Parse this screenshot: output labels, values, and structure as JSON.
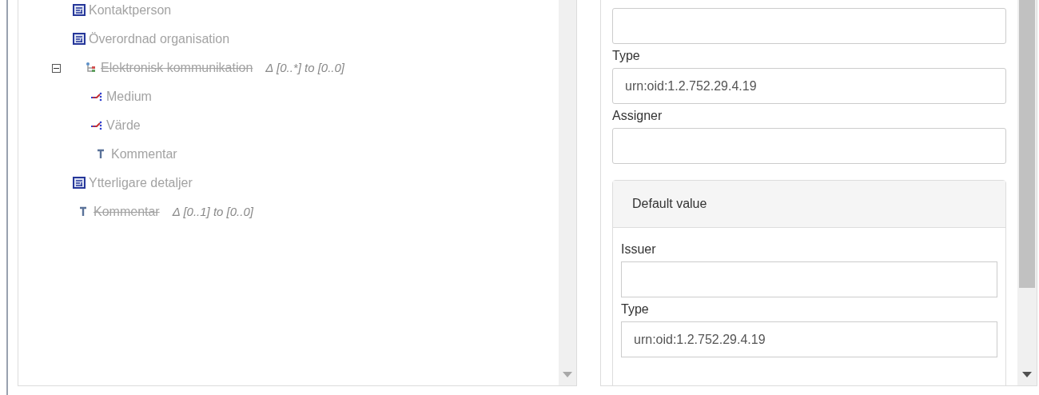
{
  "tree": {
    "items": [
      {
        "label": "Kontaktperson",
        "kind": "class",
        "deleted": false
      },
      {
        "label": "Överordnad organisation",
        "kind": "class",
        "deleted": false
      },
      {
        "label": "Elektronisk kommunikation",
        "kind": "group",
        "deleted": true,
        "delta": "Δ [0..*] to [0..0]",
        "expanded": true,
        "children": [
          {
            "label": "Medium",
            "kind": "attribute",
            "deleted": false
          },
          {
            "label": "Värde",
            "kind": "attribute",
            "deleted": false
          },
          {
            "label": "Kommentar",
            "kind": "text",
            "deleted": false
          }
        ]
      },
      {
        "label": "Ytterligare detaljer",
        "kind": "class",
        "deleted": false
      },
      {
        "label": "Kommentar",
        "kind": "text",
        "deleted": true,
        "delta": "Δ [0..1] to [0..0]"
      }
    ]
  },
  "form": {
    "fields": [
      {
        "kind": "input"
      },
      {
        "kind": "input",
        "label": "Type",
        "value": "urn:oid:1.2.752.29.4.19"
      },
      {
        "kind": "input",
        "label": "Assigner"
      }
    ],
    "default_value": {
      "title": "Default value",
      "fields": [
        {
          "kind": "input",
          "label": "Issuer"
        },
        {
          "kind": "input",
          "label": "Type",
          "value": "urn:oid:1.2.752.29.4.19"
        }
      ]
    }
  }
}
